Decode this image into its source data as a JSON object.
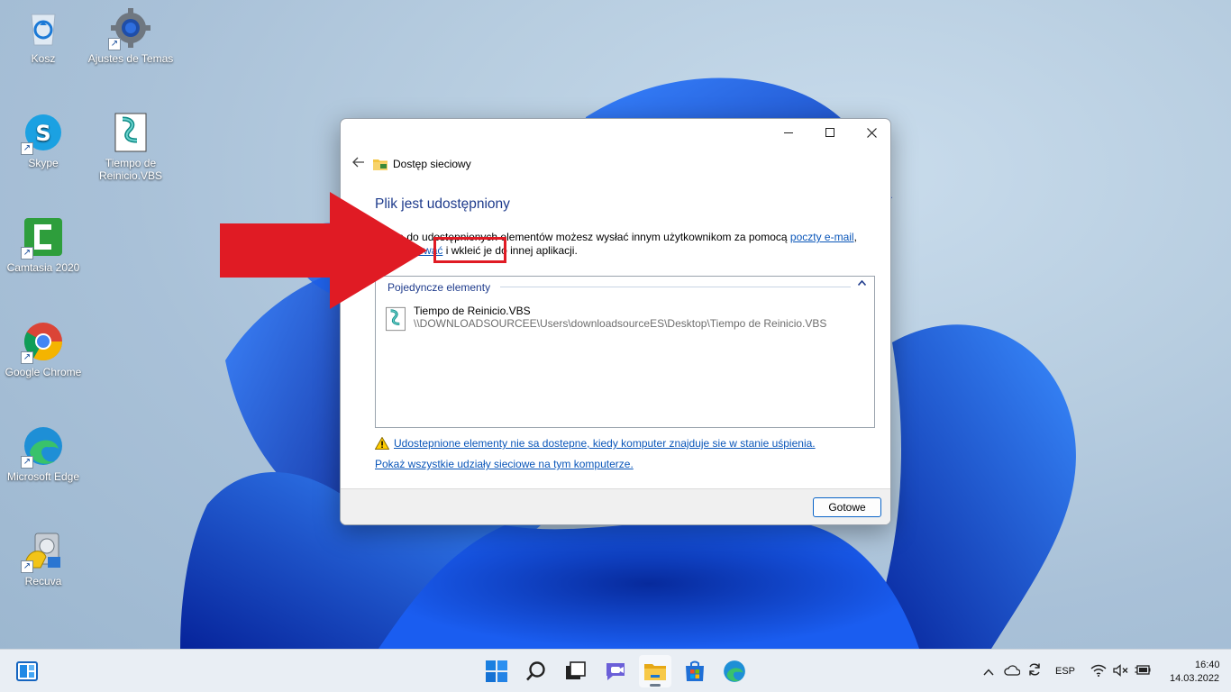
{
  "desktop": {
    "icons": [
      {
        "label": "Kosz",
        "icon": "recycle-bin-icon"
      },
      {
        "label": "Ajustes de Temas",
        "icon": "gear-icon"
      },
      {
        "label": "Skype",
        "icon": "skype-icon"
      },
      {
        "label": "Tiempo  de Reinicio.VBS",
        "icon": "vbs-script-icon"
      },
      {
        "label": "Camtasia 2020",
        "icon": "camtasia-icon"
      },
      {
        "label": "Google Chrome",
        "icon": "chrome-icon"
      },
      {
        "label": "Microsoft Edge",
        "icon": "edge-icon"
      },
      {
        "label": "Recuva",
        "icon": "recuva-icon"
      }
    ]
  },
  "dialog": {
    "nav_title": "Dostęp sieciowy",
    "heading": "Plik jest udostępniony",
    "desc_prefix": "Łącza do udostępnionych elementów możesz wysłać innym użytkownikom za pomocą",
    "desc_email_link": "poczty e-mail",
    "desc_mid": ", lub",
    "desc_copy_link": "skopiować",
    "desc_suffix": "i wkleić je do innej aplikacji.",
    "group_label": "Pojedyncze elementy",
    "item": {
      "name": "Tiempo  de Reinicio.VBS",
      "path": "\\\\DOWNLOADSOURCEE\\Users\\downloadsourceES\\Desktop\\Tiempo  de Reinicio.VBS"
    },
    "warning_link": "Udostepnione elementy nie sa dostepne, kiedy komputer znajduje sie w stanie uśpienia.",
    "show_all_link": "Pokaż wszystkie udziały sieciowe na tym komputerze.",
    "done_label": "Gotowe"
  },
  "taskbar": {
    "language": "ESP",
    "time": "16:40",
    "date": "14.03.2022"
  },
  "colors": {
    "accent": "#0a64c8",
    "annotation_red": "#e01b24",
    "heading_blue": "#1e3b8c",
    "link_blue": "#0a56b9"
  }
}
